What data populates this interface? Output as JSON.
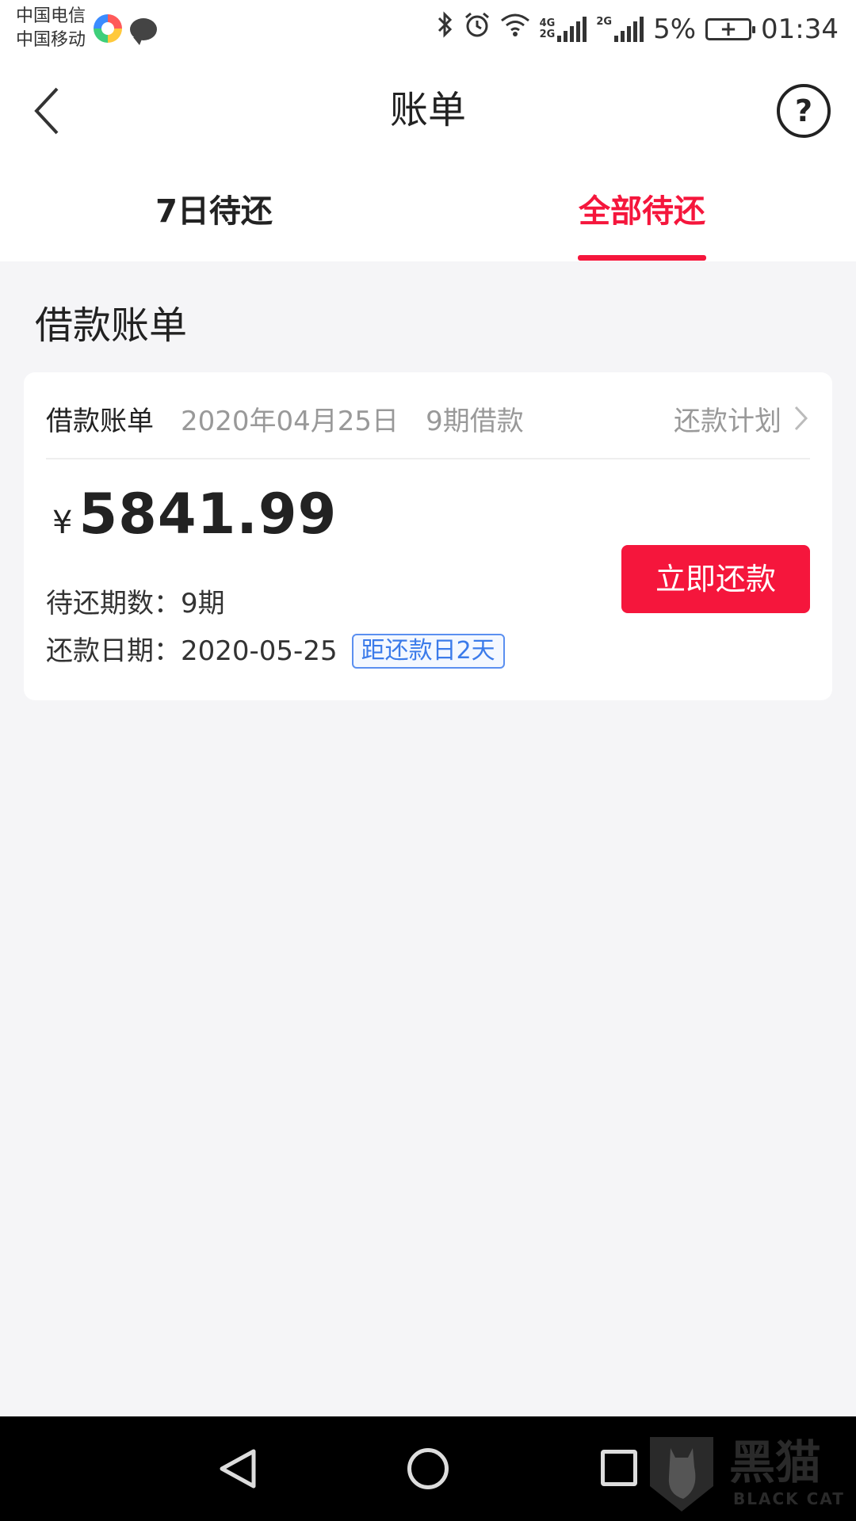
{
  "status_bar": {
    "carrier_1": "中国电信",
    "carrier_2": "中国移动",
    "network_1": "4G",
    "network_2": "2G",
    "network_3": "2G",
    "battery_percent": "5%",
    "time": "01:34"
  },
  "header": {
    "title": "账单",
    "help_label": "?"
  },
  "tabs": [
    {
      "label": "7日待还",
      "active": false
    },
    {
      "label": "全部待还",
      "active": true
    }
  ],
  "section": {
    "title": "借款账单"
  },
  "bill_card": {
    "title": "借款账单",
    "date": "2020年04月25日",
    "periods": "9期借款",
    "plan_link": "还款计划",
    "currency": "¥",
    "amount": "5841.99",
    "remaining_label": "待还期数：",
    "remaining_value": "9期",
    "due_label": "还款日期：",
    "due_value": "2020-05-25",
    "due_badge": "距还款日2天",
    "repay_button": "立即还款"
  },
  "watermark": {
    "text": "黑猫",
    "sub": "BLACK CAT"
  },
  "colors": {
    "accent": "#f5163c",
    "badge_blue": "#3b7bea",
    "background": "#f5f5f7"
  }
}
